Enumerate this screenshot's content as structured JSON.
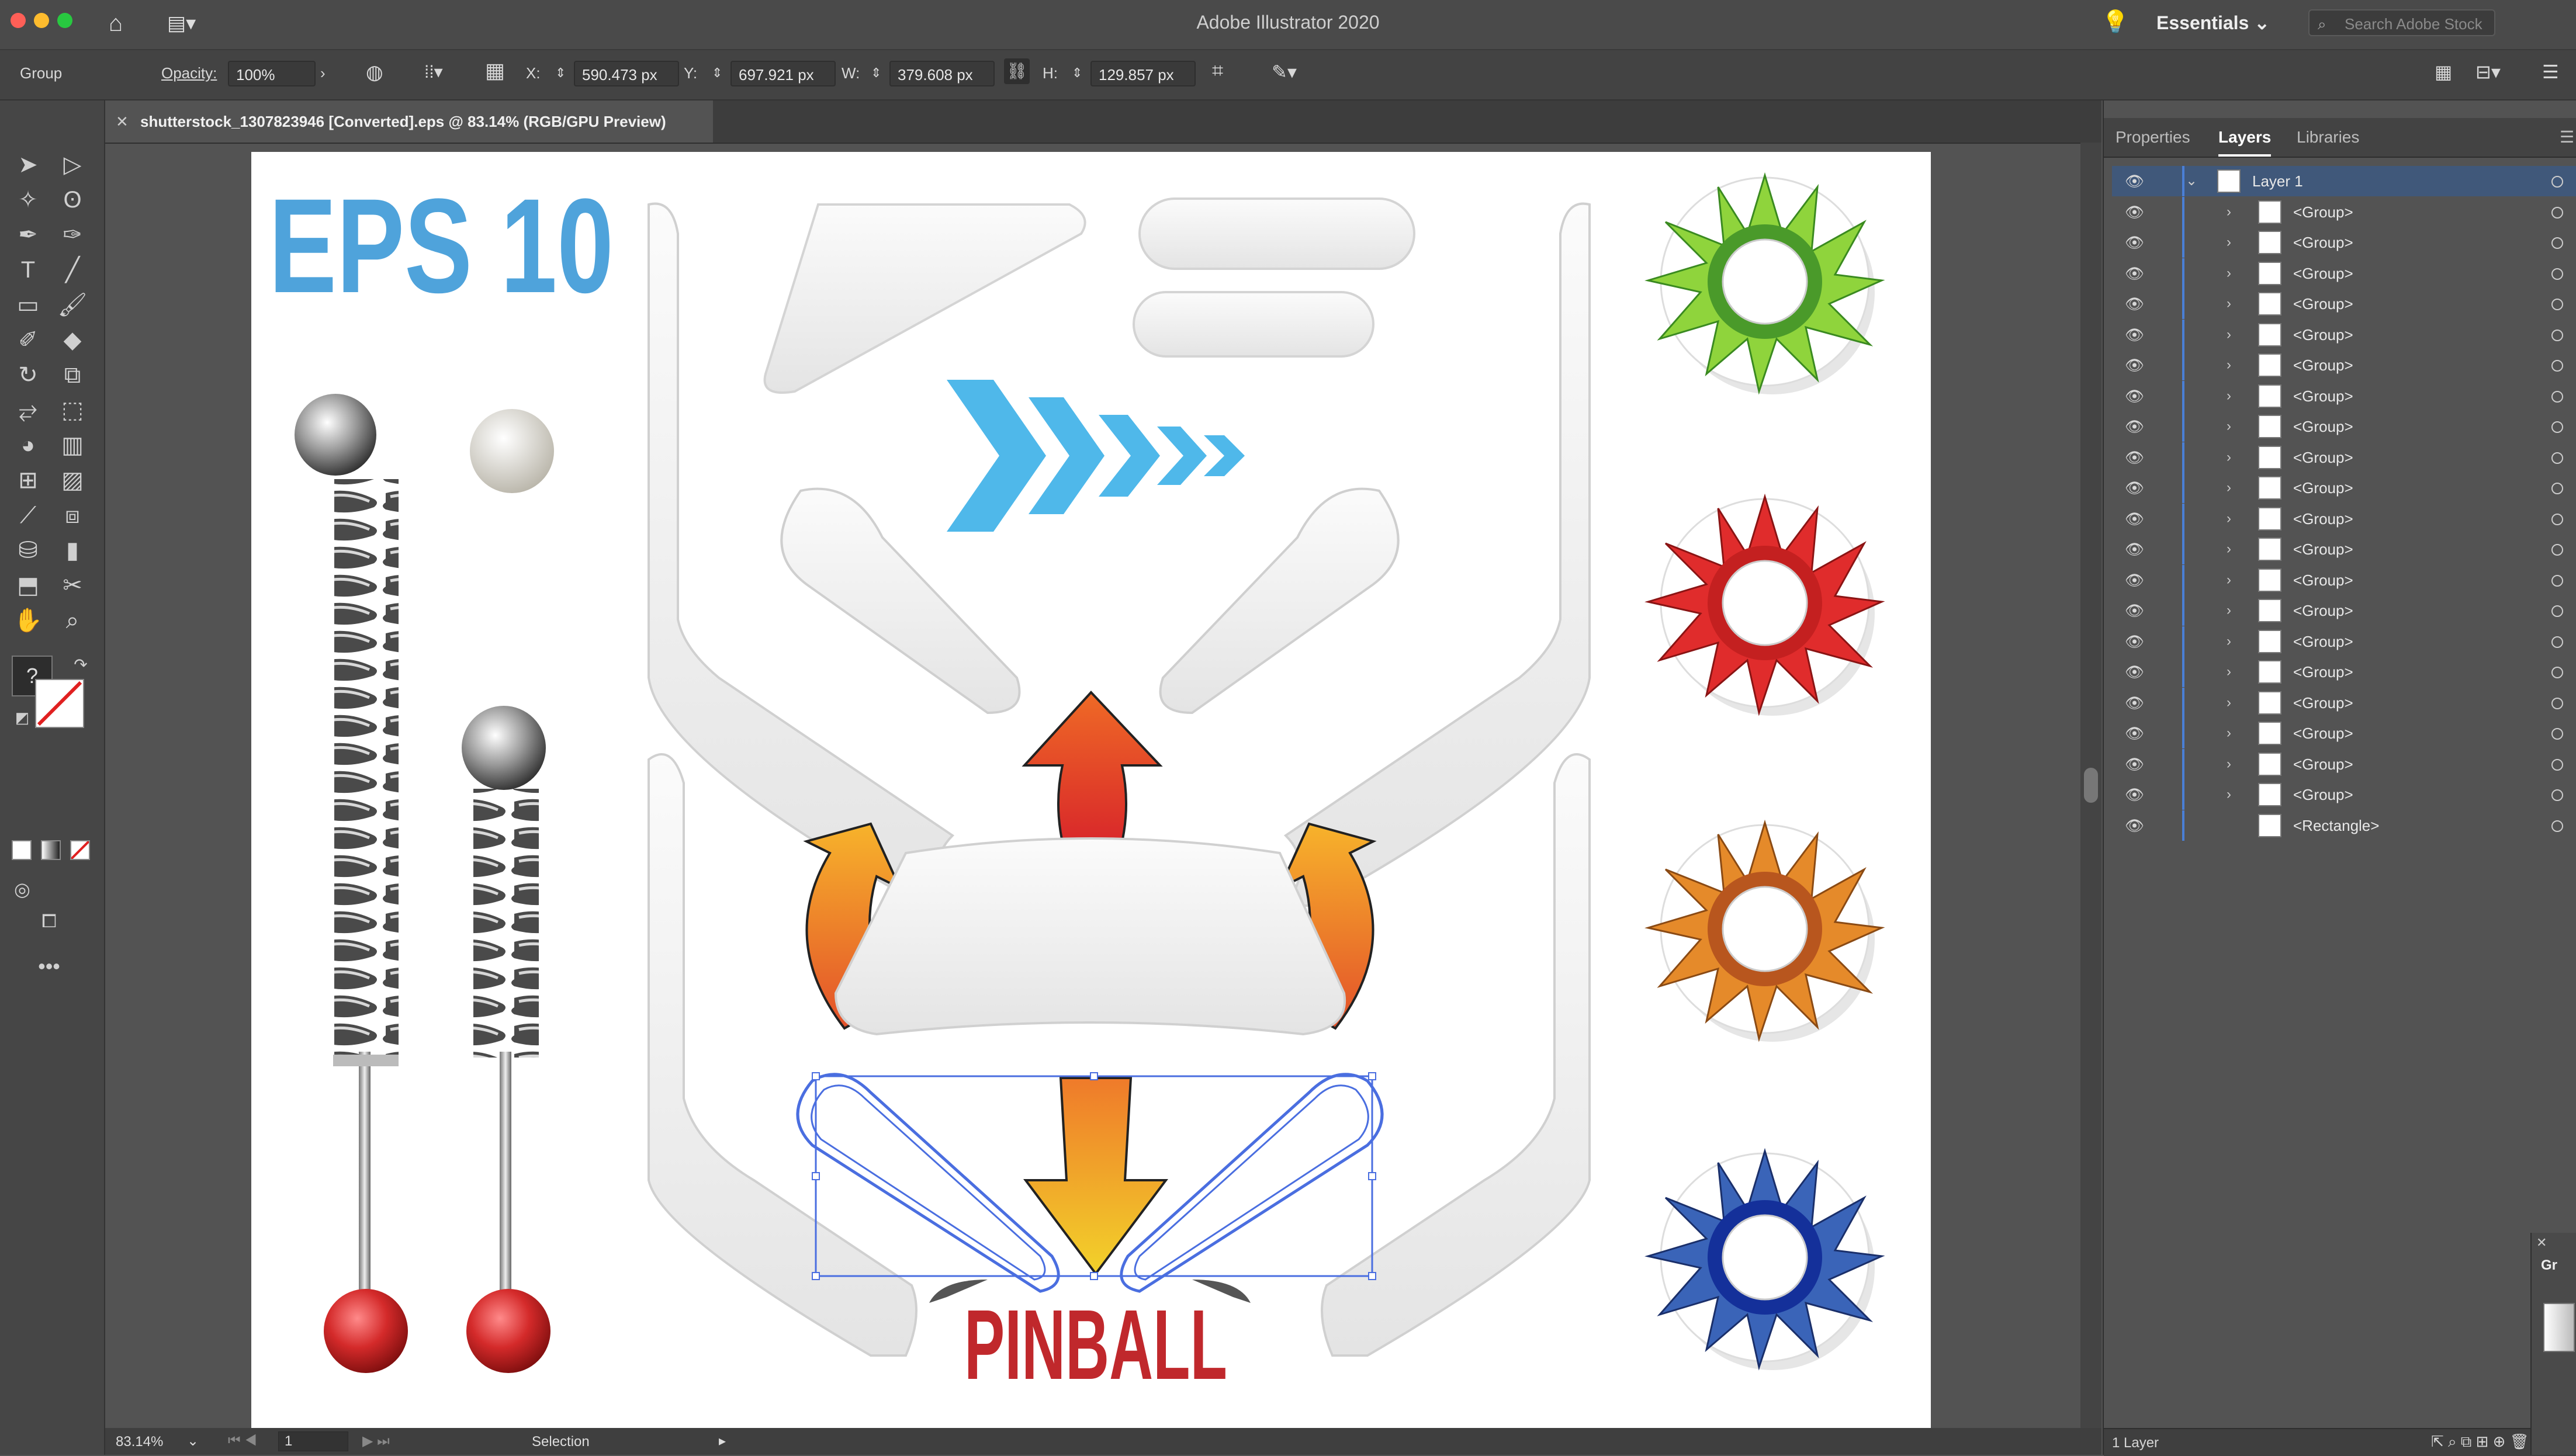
{
  "app": {
    "title": "Adobe Illustrator 2020",
    "workspace": "Essentials",
    "search_placeholder": "Search Adobe Stock"
  },
  "control_bar": {
    "selection_type": "Group",
    "opacity_label": "Opacity:",
    "opacity_value": "100%",
    "x_label": "X:",
    "x_value": "590.473 px",
    "y_label": "Y:",
    "y_value": "697.921 px",
    "w_label": "W:",
    "w_value": "379.608 px",
    "h_label": "H:",
    "h_value": "129.857 px"
  },
  "document": {
    "tab_title": "shutterstock_1307823946 [Converted].eps @ 83.14% (RGB/GPU Preview)"
  },
  "artwork": {
    "eps_label": "EPS 10",
    "pinball_label": "PINBALL"
  },
  "status_bar": {
    "zoom": "83.14%",
    "artboard": "1",
    "tool": "Selection"
  },
  "panel": {
    "tabs": [
      "Properties",
      "Layers",
      "Libraries"
    ],
    "active_tab": "Layers",
    "layer_name": "Layer 1",
    "items": [
      "<Group>",
      "<Group>",
      "<Group>",
      "<Group>",
      "<Group>",
      "<Group>",
      "<Group>",
      "<Group>",
      "<Group>",
      "<Group>",
      "<Group>",
      "<Group>",
      "<Group>",
      "<Group>",
      "<Group>",
      "<Group>",
      "<Group>",
      "<Group>",
      "<Group>",
      "<Group>",
      "<Rectangle>"
    ],
    "footer": "1 Layer"
  },
  "colors": {
    "accent_blue": "#4a7fd6",
    "eps_blue": "#4fa3db",
    "pinball_red": "#c0282c"
  }
}
